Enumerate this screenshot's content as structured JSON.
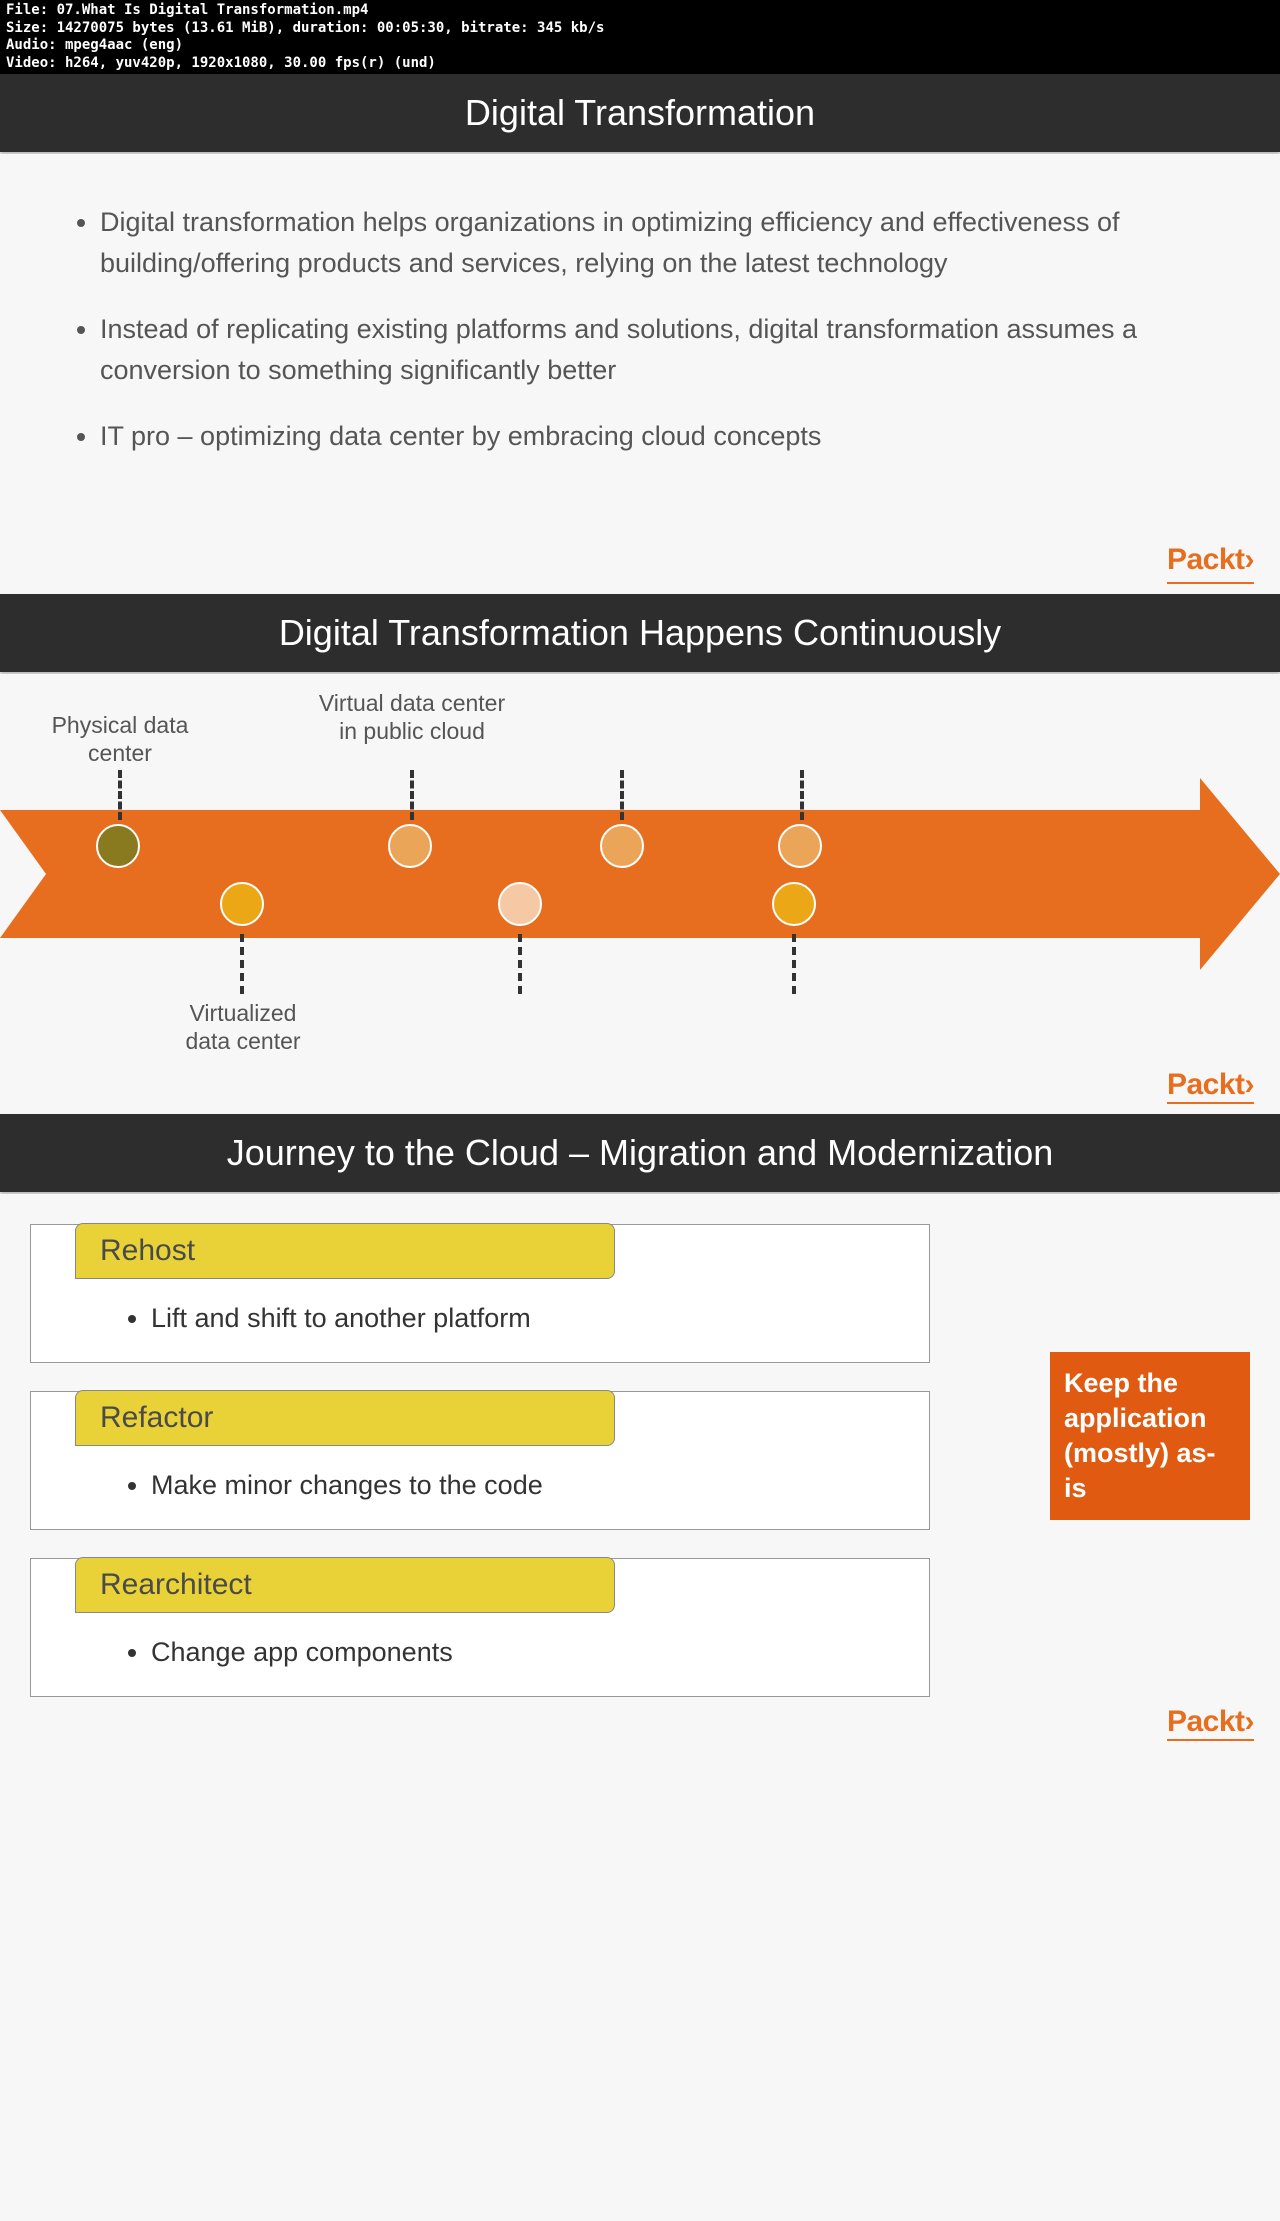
{
  "metadata": {
    "line1": "File: 07.What Is Digital Transformation.mp4",
    "line2": "Size: 14270075 bytes (13.61 MiB), duration: 00:05:30, bitrate: 345 kb/s",
    "line3": "Audio: mpeg4aac (eng)",
    "line4": "Video: h264, yuv420p, 1920x1080, 30.00 fps(r) (und)"
  },
  "brand": "Packt›",
  "slide1": {
    "title": "Digital Transformation",
    "bullets": [
      "Digital transformation helps organizations in optimizing efficiency and effectiveness of building/offering products and services, relying on the latest technology",
      "Instead of replicating existing platforms and solutions, digital transformation assumes a conversion to something significantly better",
      "IT pro – optimizing data center by embracing cloud concepts"
    ]
  },
  "slide2": {
    "title": "Digital Transformation Happens Continuously",
    "labels": {
      "physical": "Physical data center",
      "virtualized": "Virtualized data center",
      "virtual_public": "Virtual data center in public cloud"
    }
  },
  "slide3": {
    "title": "Journey to the Cloud – Migration and Modernization",
    "cards": [
      {
        "tab": "Rehost",
        "bullet": "Lift and shift to another platform"
      },
      {
        "tab": "Refactor",
        "bullet": "Make minor changes to the code"
      },
      {
        "tab": "Rearchitect",
        "bullet": "Change app components"
      }
    ],
    "aside": "Keep the application (mostly) as-is"
  }
}
